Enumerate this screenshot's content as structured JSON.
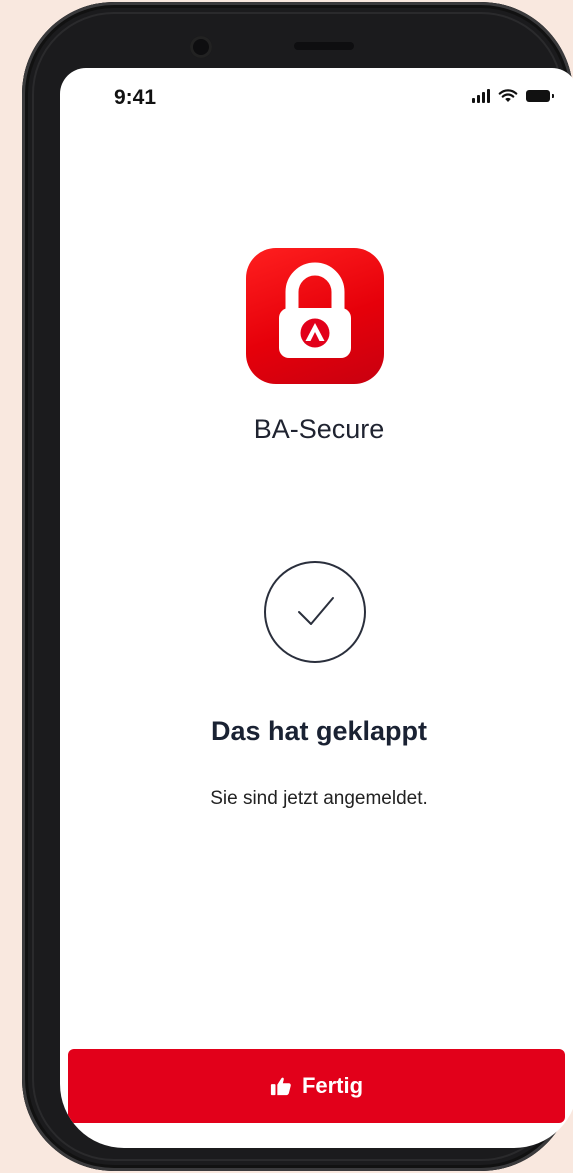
{
  "status_bar": {
    "time": "9:41",
    "signal_icon": "cellular-signal-icon",
    "wifi_icon": "wifi-icon",
    "battery_icon": "battery-icon"
  },
  "app": {
    "icon": "padlock-app-icon",
    "name": "BA-Secure"
  },
  "result": {
    "icon": "checkmark-circle-icon",
    "title": "Das hat geklappt",
    "message": "Sie sind jetzt angemeldet."
  },
  "footer": {
    "button_icon": "thumbs-up-icon",
    "button_label": "Fertig"
  },
  "colors": {
    "brand_red": "#e2001a",
    "background": "#f9e8df",
    "title_text": "#1a2233"
  }
}
